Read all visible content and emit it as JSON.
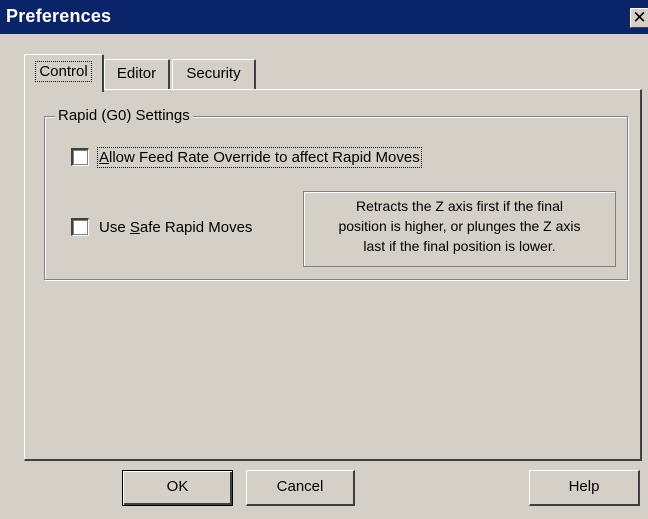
{
  "window": {
    "title": "Preferences",
    "close_glyph": "✕"
  },
  "tabs": [
    {
      "label": "Control",
      "active": true
    },
    {
      "label": "Editor",
      "active": false
    },
    {
      "label": "Security",
      "active": false
    }
  ],
  "rapid_group": {
    "title": "Rapid (G0) Settings",
    "feed_rate_override": {
      "label_mnemonic": "A",
      "label_rest": "llow Feed Rate Override to affect Rapid Moves",
      "checked": false
    },
    "safe_rapid": {
      "label_pre": "Use ",
      "label_mnemonic": "S",
      "label_rest": "afe Rapid Moves",
      "checked": false
    },
    "description_lines": [
      "Retracts the Z axis first if the final",
      "position is higher, or plunges the Z axis",
      "last if the final position is lower."
    ]
  },
  "buttons": {
    "ok": "OK",
    "cancel": "Cancel",
    "help": "Help"
  },
  "colors": {
    "titlebar": "#0a246a",
    "face": "#d4d0c8"
  }
}
